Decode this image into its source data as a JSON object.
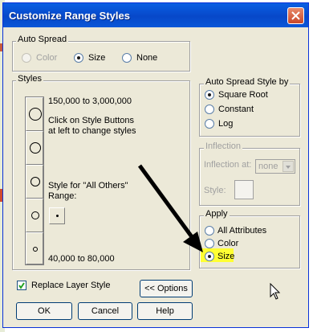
{
  "window": {
    "title": "Customize Range Styles"
  },
  "auto_spread": {
    "label": "Auto Spread",
    "options": [
      {
        "label": "Color",
        "checked": false,
        "disabled": true
      },
      {
        "label": "Size",
        "checked": true,
        "disabled": false
      },
      {
        "label": "None",
        "checked": false,
        "disabled": false
      }
    ]
  },
  "styles": {
    "label": "Styles",
    "range_top": "150,000 to 3,000,000",
    "hint_line1": "Click on Style Buttons",
    "hint_line2": "at left to change styles",
    "others_line1": "Style for \"All Others\"",
    "others_line2": "Range:",
    "range_bottom": "40,000 to 80,000"
  },
  "auto_spread_by": {
    "label": "Auto Spread Style by",
    "options": [
      {
        "label": "Square Root",
        "checked": true
      },
      {
        "label": "Constant",
        "checked": false
      },
      {
        "label": "Log",
        "checked": false
      }
    ]
  },
  "inflection": {
    "label": "Inflection",
    "at_label": "Inflection at:",
    "at_value": "none",
    "style_label": "Style:"
  },
  "apply": {
    "label": "Apply",
    "options": [
      {
        "label": "All Attributes",
        "checked": false
      },
      {
        "label": "Color",
        "checked": false
      },
      {
        "label": "Size",
        "checked": true
      }
    ],
    "highlight_color": "#ffff33"
  },
  "replace_layer_style": {
    "label": "Replace Layer Style",
    "checked": true
  },
  "buttons": {
    "options": "<< Options",
    "ok": "OK",
    "cancel": "Cancel",
    "help": "Help"
  },
  "colors": {
    "title_bar": "#0a5fe3",
    "dialog_bg": "#ece9d8",
    "disabled_text": "#a0a0a0"
  }
}
